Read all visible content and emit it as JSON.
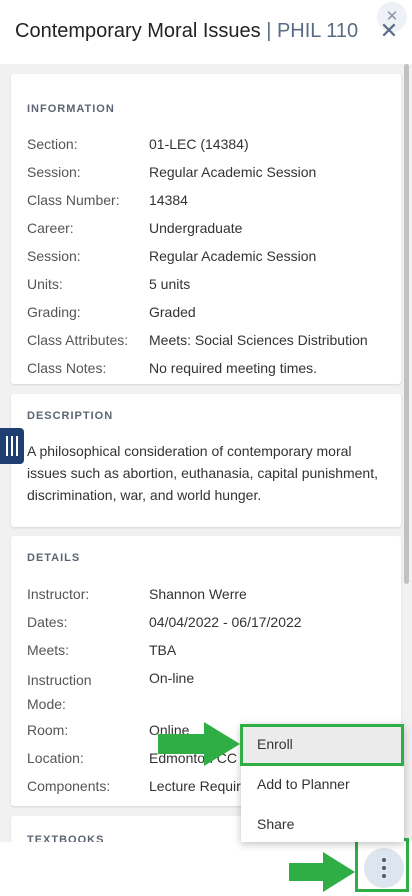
{
  "header": {
    "course_name": "Contemporary Moral Issues",
    "separator": " | ",
    "course_code": "PHIL 110",
    "close_glyph": "✕"
  },
  "information": {
    "title": "INFORMATION",
    "rows": [
      {
        "label": "Section:",
        "value": "01-LEC (14384)"
      },
      {
        "label": "Session:",
        "value": "Regular Academic Session"
      },
      {
        "label": "Class Number:",
        "value": "14384"
      },
      {
        "label": "Career:",
        "value": "Undergraduate"
      },
      {
        "label": "Session:",
        "value": "Regular Academic Session"
      },
      {
        "label": "Units:",
        "value": "5 units"
      },
      {
        "label": "Grading:",
        "value": "Graded"
      },
      {
        "label": "Class Attributes:",
        "value": "Meets: Social Sciences Distribution"
      },
      {
        "label": "Class Notes:",
        "value": "No required meeting times."
      }
    ]
  },
  "description": {
    "title": "DESCRIPTION",
    "text": "A philosophical consideration of contemporary moral issues such as abortion, euthanasia, capital punishment, discrimination, war, and world hunger."
  },
  "details": {
    "title": "DETAILS",
    "rows": [
      {
        "label": "Instructor:",
        "value": "Shannon Werre"
      },
      {
        "label": "Dates:",
        "value": "04/04/2022 - 06/17/2022"
      },
      {
        "label": "Meets:",
        "value": "TBA"
      },
      {
        "label": "Instruction Mode:",
        "value": "On-line"
      },
      {
        "label": "Room:",
        "value": "Online"
      },
      {
        "label": "Location:",
        "value": "Edmonton CC"
      },
      {
        "label": "Components:",
        "value": "Lecture Required"
      }
    ]
  },
  "textbooks": {
    "title": "TEXTBOOKS"
  },
  "menu": {
    "items": [
      {
        "label": "Enroll"
      },
      {
        "label": "Add to Planner"
      },
      {
        "label": "Share"
      }
    ]
  },
  "colors": {
    "accent_green": "#2eae45",
    "handle_blue": "#1f3f73",
    "code_gray_blue": "#5a6b85"
  },
  "icons": {
    "close": "close-icon",
    "more": "more-vertical-icon",
    "handle": "sidebar-handle-icon",
    "arrow": "arrow-right-icon"
  }
}
